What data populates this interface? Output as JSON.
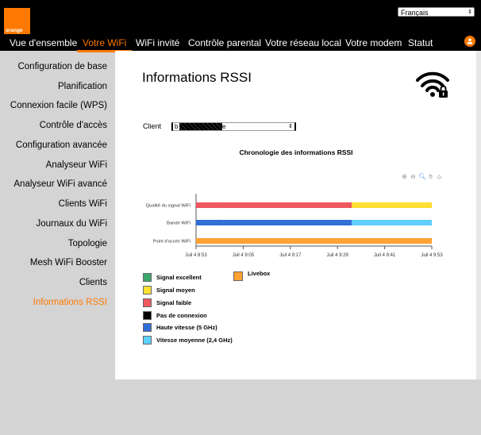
{
  "header": {
    "brand": "orange",
    "language": "Français",
    "nav": [
      {
        "label": "Vue d'ensemble",
        "active": false
      },
      {
        "label": "Votre WiFi",
        "active": true
      },
      {
        "label": "WiFi invité",
        "active": false
      },
      {
        "label": "Contrôle parental",
        "active": false
      },
      {
        "label": "Votre réseau local",
        "active": false
      },
      {
        "label": "Votre modem",
        "active": false
      },
      {
        "label": "Statut",
        "active": false
      }
    ],
    "user_icon": "user-icon"
  },
  "sidebar": {
    "items": [
      {
        "label": "Configuration de base",
        "active": false
      },
      {
        "label": "Planification",
        "active": false
      },
      {
        "label": "Connexion facile (WPS)",
        "active": false
      },
      {
        "label": "Contrôle d'accès",
        "active": false
      },
      {
        "label": "Configuration avancée",
        "active": false
      },
      {
        "label": "Analyseur WiFi",
        "active": false
      },
      {
        "label": "Analyseur WiFi avancé",
        "active": false
      },
      {
        "label": "Clients WiFi",
        "active": false
      },
      {
        "label": "Journaux du WiFi",
        "active": false
      },
      {
        "label": "Topologie",
        "active": false
      },
      {
        "label": "Mesh WiFi Booster",
        "active": false
      },
      {
        "label": "Clients",
        "active": false
      },
      {
        "label": "Informations RSSI",
        "active": true
      }
    ]
  },
  "main": {
    "title": "Informations RSSI",
    "client_label": "Client",
    "client_value_prefix": "b",
    "client_value_suffix": "e",
    "toolbar": [
      "zoom-in-icon",
      "zoom-out-icon",
      "zoom-select-icon",
      "pan-icon",
      "home-icon"
    ]
  },
  "colors": {
    "accent": "#ff7900",
    "signal_excellent": "#3aa76d",
    "signal_moyen": "#ffe033",
    "signal_faible": "#f0575f",
    "pas_de_connexion": "#000000",
    "haute_vitesse": "#2f6fd6",
    "vitesse_moyenne": "#5fd0ff",
    "livebox": "#ffa232"
  },
  "chart_data": {
    "type": "timeline",
    "title": "Chronologie des informations RSSI",
    "rows": [
      "Qualité du signal WiFi",
      "Bande WiFi",
      "Point d'accès WiFi"
    ],
    "x_ticks": [
      "Juil 4 8:53",
      "Juil 4 9:05",
      "Juil 4 9:17",
      "Juil 4 9:29",
      "Juil 4 9:41",
      "Juil 4 9:53"
    ],
    "x_range_minutes": [
      0,
      60
    ],
    "x_start_label": "Juil 4 8:53",
    "segments": [
      {
        "row": 0,
        "start": 0,
        "end": 7,
        "state": "Signal faible"
      },
      {
        "row": 0,
        "start": 7,
        "end": 39.6,
        "state": "Signal faible"
      },
      {
        "row": 0,
        "start": 39.6,
        "end": 60,
        "state": "Signal moyen"
      },
      {
        "row": 1,
        "start": 0,
        "end": 7,
        "state": "Haute vitesse (5 GHz)"
      },
      {
        "row": 1,
        "start": 7,
        "end": 39.6,
        "state": "Haute vitesse (5 GHz)"
      },
      {
        "row": 1,
        "start": 39.6,
        "end": 60,
        "state": "Vitesse moyenne (2,4 GHz)"
      },
      {
        "row": 2,
        "start": 0,
        "end": 60,
        "state": "Livebox"
      }
    ],
    "legend": [
      {
        "label": "Signal excellent",
        "color": "#3aa76d"
      },
      {
        "label": "Signal moyen",
        "color": "#ffe033"
      },
      {
        "label": "Signal faible",
        "color": "#f0575f"
      },
      {
        "label": "Pas de connexion",
        "color": "#000000"
      },
      {
        "label": "Haute vitesse (5 GHz)",
        "color": "#2f6fd6"
      },
      {
        "label": "Vitesse moyenne (2,4 GHz)",
        "color": "#5fd0ff"
      },
      {
        "label": "Livebox",
        "color": "#ffa232"
      }
    ]
  }
}
